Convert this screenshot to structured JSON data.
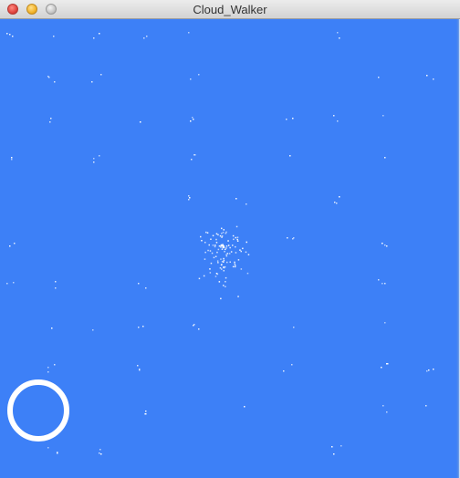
{
  "window": {
    "title": "Cloud_Walker"
  },
  "scene": {
    "background_color": "#3d80f7",
    "particle_color": "#ffffff"
  },
  "icons": {
    "close": "close-button-icon",
    "minimize": "minimize-button-icon",
    "maximize": "maximize-button-icon",
    "ring": "ring-indicator-icon"
  }
}
